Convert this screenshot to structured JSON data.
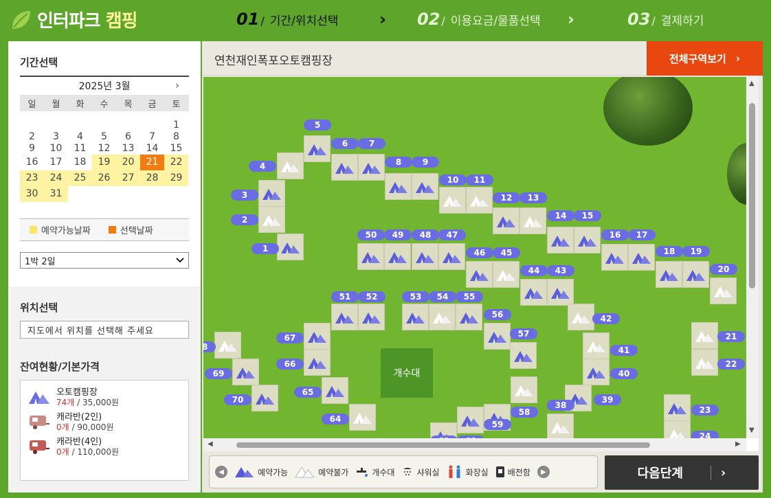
{
  "brand": {
    "name": "인터파크",
    "sub": "캠핑"
  },
  "steps": [
    {
      "num": "01",
      "label": "기간/위치선택"
    },
    {
      "num": "02",
      "label": "이용요금/물품선택"
    },
    {
      "num": "03",
      "label": "결제하기"
    }
  ],
  "period": {
    "title": "기간선택",
    "month_label": "2025년  3월",
    "weekdays": [
      "일",
      "월",
      "화",
      "수",
      "목",
      "금",
      "토"
    ],
    "legend_available": "예약가능날짜",
    "legend_selected": "선택날짜",
    "stay_option": "1박 2일"
  },
  "location": {
    "title": "위치선택",
    "placeholder": "지도에서 위치를 선택해 주세요"
  },
  "stock": {
    "title": "잔여현황/기본가격",
    "items": [
      {
        "name": "오토캠핑장",
        "count": "74개",
        "price": " / 35,000원"
      },
      {
        "name": "캐라반(2인)",
        "count": "0개",
        "price": " / 90,000원"
      },
      {
        "name": "캐라반(4인)",
        "count": "0개",
        "price": " / 110,000원"
      }
    ]
  },
  "map": {
    "site_title": "연천재인폭포오토캠핑장",
    "all_button": "전체구역보기",
    "water_label": "개수대"
  },
  "legend_bar": {
    "available": "예약가능",
    "unavailable": "예약불가",
    "sink": "개수대",
    "shower": "샤워실",
    "toilet": "화장실",
    "power": "배전함"
  },
  "next_button": "다음단계",
  "colors": {
    "brand_green": "#5ea52c",
    "accent_orange": "#e8470f",
    "selected_day": "#f07c12",
    "available_day": "#fdf3a2",
    "pill_blue": "#6a6de2"
  }
}
